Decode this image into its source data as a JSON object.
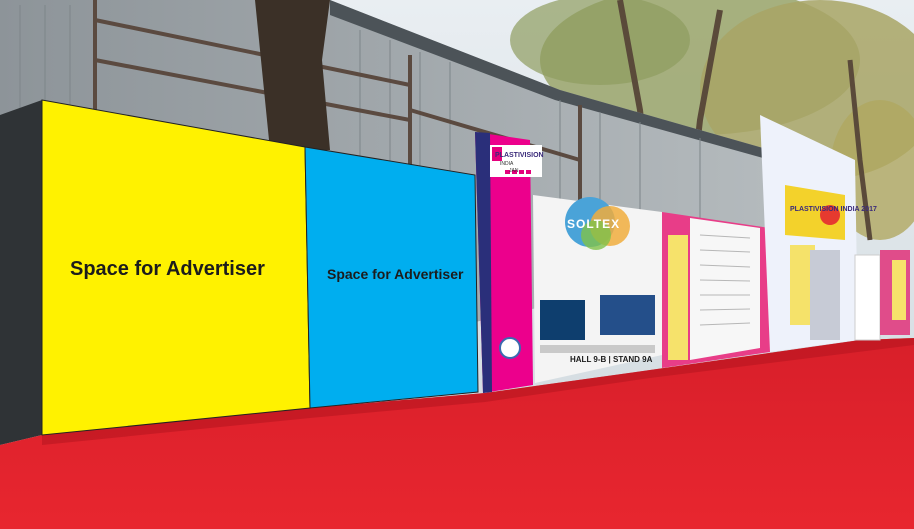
{
  "scene": {
    "left_billboard_text": "Space for Advertiser",
    "middle_billboard_text": "Space for Advertiser",
    "pillar_logo_text": "PLASTIVISION",
    "pillar_logo_sub": "INDIA",
    "pillar_logo_date": "JAN",
    "banner_brand_text": "SOLTEX",
    "banner_hall_text": "HALL 9-B | STAND 9A",
    "right_banner_text": "PLASTIVISION INDIA 2017"
  },
  "colors": {
    "yellow_panel": "#fff200",
    "blue_panel": "#00aeef",
    "magenta_pillar": "#ec008c",
    "red_carpet": "#e01f28"
  }
}
